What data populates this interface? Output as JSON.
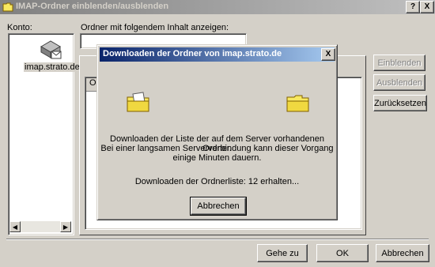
{
  "window": {
    "title": "IMAP-Ordner einblenden/ausblenden",
    "help_btn": "?",
    "close_btn": "X"
  },
  "account": {
    "label": "Konto:",
    "name": "imap.strato.de",
    "icon": "server-mailbox-icon"
  },
  "filter": {
    "label": "Ordner mit folgendem Inhalt anzeigen:",
    "value": ""
  },
  "folder_list": {
    "column_header": "Ord"
  },
  "side_buttons": {
    "show": "Einblenden",
    "hide": "Ausblenden",
    "reset": "Zurücksetzen"
  },
  "footer_buttons": {
    "goto": "Gehe zu",
    "ok": "OK",
    "cancel": "Abbrechen"
  },
  "dialog": {
    "title": "Downloaden der Ordner von imap.strato.de",
    "close_btn": "X",
    "message_line1": "Downloaden der Liste der auf dem Server vorhandenen Ordner.",
    "message_line2": "Bei einer langsamen Serververbindung kann dieser Vorgang",
    "message_line3": "einige Minuten dauern.",
    "status": "Downloaden der Ordnerliste: 12 erhalten...",
    "cancel_btn": "Abbrechen"
  },
  "colors": {
    "face": "#d4d0c8",
    "active_title": "#0a246a",
    "inactive_title": "#808080",
    "folder_yellow": "#f8e860"
  }
}
